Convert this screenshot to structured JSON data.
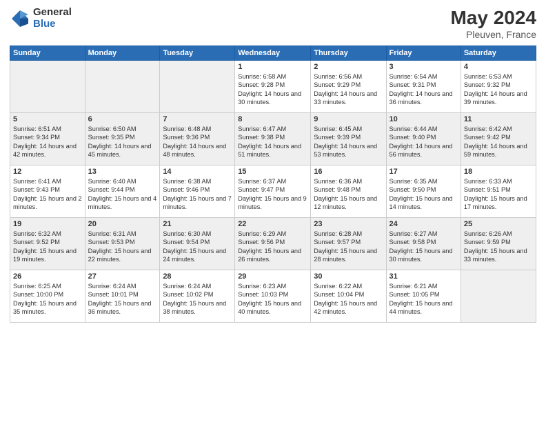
{
  "header": {
    "logo_general": "General",
    "logo_blue": "Blue",
    "month": "May 2024",
    "location": "Pleuven, France"
  },
  "days_of_week": [
    "Sunday",
    "Monday",
    "Tuesday",
    "Wednesday",
    "Thursday",
    "Friday",
    "Saturday"
  ],
  "weeks": [
    [
      {
        "day": "",
        "sunrise": "",
        "sunset": "",
        "daylight": ""
      },
      {
        "day": "",
        "sunrise": "",
        "sunset": "",
        "daylight": ""
      },
      {
        "day": "",
        "sunrise": "",
        "sunset": "",
        "daylight": ""
      },
      {
        "day": "1",
        "sunrise": "Sunrise: 6:58 AM",
        "sunset": "Sunset: 9:28 PM",
        "daylight": "Daylight: 14 hours and 30 minutes."
      },
      {
        "day": "2",
        "sunrise": "Sunrise: 6:56 AM",
        "sunset": "Sunset: 9:29 PM",
        "daylight": "Daylight: 14 hours and 33 minutes."
      },
      {
        "day": "3",
        "sunrise": "Sunrise: 6:54 AM",
        "sunset": "Sunset: 9:31 PM",
        "daylight": "Daylight: 14 hours and 36 minutes."
      },
      {
        "day": "4",
        "sunrise": "Sunrise: 6:53 AM",
        "sunset": "Sunset: 9:32 PM",
        "daylight": "Daylight: 14 hours and 39 minutes."
      }
    ],
    [
      {
        "day": "5",
        "sunrise": "Sunrise: 6:51 AM",
        "sunset": "Sunset: 9:34 PM",
        "daylight": "Daylight: 14 hours and 42 minutes."
      },
      {
        "day": "6",
        "sunrise": "Sunrise: 6:50 AM",
        "sunset": "Sunset: 9:35 PM",
        "daylight": "Daylight: 14 hours and 45 minutes."
      },
      {
        "day": "7",
        "sunrise": "Sunrise: 6:48 AM",
        "sunset": "Sunset: 9:36 PM",
        "daylight": "Daylight: 14 hours and 48 minutes."
      },
      {
        "day": "8",
        "sunrise": "Sunrise: 6:47 AM",
        "sunset": "Sunset: 9:38 PM",
        "daylight": "Daylight: 14 hours and 51 minutes."
      },
      {
        "day": "9",
        "sunrise": "Sunrise: 6:45 AM",
        "sunset": "Sunset: 9:39 PM",
        "daylight": "Daylight: 14 hours and 53 minutes."
      },
      {
        "day": "10",
        "sunrise": "Sunrise: 6:44 AM",
        "sunset": "Sunset: 9:40 PM",
        "daylight": "Daylight: 14 hours and 56 minutes."
      },
      {
        "day": "11",
        "sunrise": "Sunrise: 6:42 AM",
        "sunset": "Sunset: 9:42 PM",
        "daylight": "Daylight: 14 hours and 59 minutes."
      }
    ],
    [
      {
        "day": "12",
        "sunrise": "Sunrise: 6:41 AM",
        "sunset": "Sunset: 9:43 PM",
        "daylight": "Daylight: 15 hours and 2 minutes."
      },
      {
        "day": "13",
        "sunrise": "Sunrise: 6:40 AM",
        "sunset": "Sunset: 9:44 PM",
        "daylight": "Daylight: 15 hours and 4 minutes."
      },
      {
        "day": "14",
        "sunrise": "Sunrise: 6:38 AM",
        "sunset": "Sunset: 9:46 PM",
        "daylight": "Daylight: 15 hours and 7 minutes."
      },
      {
        "day": "15",
        "sunrise": "Sunrise: 6:37 AM",
        "sunset": "Sunset: 9:47 PM",
        "daylight": "Daylight: 15 hours and 9 minutes."
      },
      {
        "day": "16",
        "sunrise": "Sunrise: 6:36 AM",
        "sunset": "Sunset: 9:48 PM",
        "daylight": "Daylight: 15 hours and 12 minutes."
      },
      {
        "day": "17",
        "sunrise": "Sunrise: 6:35 AM",
        "sunset": "Sunset: 9:50 PM",
        "daylight": "Daylight: 15 hours and 14 minutes."
      },
      {
        "day": "18",
        "sunrise": "Sunrise: 6:33 AM",
        "sunset": "Sunset: 9:51 PM",
        "daylight": "Daylight: 15 hours and 17 minutes."
      }
    ],
    [
      {
        "day": "19",
        "sunrise": "Sunrise: 6:32 AM",
        "sunset": "Sunset: 9:52 PM",
        "daylight": "Daylight: 15 hours and 19 minutes."
      },
      {
        "day": "20",
        "sunrise": "Sunrise: 6:31 AM",
        "sunset": "Sunset: 9:53 PM",
        "daylight": "Daylight: 15 hours and 22 minutes."
      },
      {
        "day": "21",
        "sunrise": "Sunrise: 6:30 AM",
        "sunset": "Sunset: 9:54 PM",
        "daylight": "Daylight: 15 hours and 24 minutes."
      },
      {
        "day": "22",
        "sunrise": "Sunrise: 6:29 AM",
        "sunset": "Sunset: 9:56 PM",
        "daylight": "Daylight: 15 hours and 26 minutes."
      },
      {
        "day": "23",
        "sunrise": "Sunrise: 6:28 AM",
        "sunset": "Sunset: 9:57 PM",
        "daylight": "Daylight: 15 hours and 28 minutes."
      },
      {
        "day": "24",
        "sunrise": "Sunrise: 6:27 AM",
        "sunset": "Sunset: 9:58 PM",
        "daylight": "Daylight: 15 hours and 30 minutes."
      },
      {
        "day": "25",
        "sunrise": "Sunrise: 6:26 AM",
        "sunset": "Sunset: 9:59 PM",
        "daylight": "Daylight: 15 hours and 33 minutes."
      }
    ],
    [
      {
        "day": "26",
        "sunrise": "Sunrise: 6:25 AM",
        "sunset": "Sunset: 10:00 PM",
        "daylight": "Daylight: 15 hours and 35 minutes."
      },
      {
        "day": "27",
        "sunrise": "Sunrise: 6:24 AM",
        "sunset": "Sunset: 10:01 PM",
        "daylight": "Daylight: 15 hours and 36 minutes."
      },
      {
        "day": "28",
        "sunrise": "Sunrise: 6:24 AM",
        "sunset": "Sunset: 10:02 PM",
        "daylight": "Daylight: 15 hours and 38 minutes."
      },
      {
        "day": "29",
        "sunrise": "Sunrise: 6:23 AM",
        "sunset": "Sunset: 10:03 PM",
        "daylight": "Daylight: 15 hours and 40 minutes."
      },
      {
        "day": "30",
        "sunrise": "Sunrise: 6:22 AM",
        "sunset": "Sunset: 10:04 PM",
        "daylight": "Daylight: 15 hours and 42 minutes."
      },
      {
        "day": "31",
        "sunrise": "Sunrise: 6:21 AM",
        "sunset": "Sunset: 10:05 PM",
        "daylight": "Daylight: 15 hours and 44 minutes."
      },
      {
        "day": "",
        "sunrise": "",
        "sunset": "",
        "daylight": ""
      }
    ]
  ]
}
